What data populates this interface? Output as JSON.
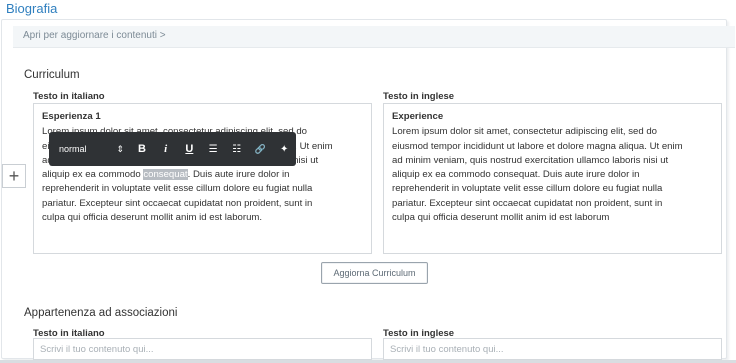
{
  "section_title": "Biografia",
  "expand_bar_label": "Apri per aggiornare i contenuti >",
  "curriculum": {
    "heading": "Curriculum",
    "label_it": "Testo in italiano",
    "label_en": "Testo in inglese",
    "it": {
      "heading": "Esperienza 1",
      "line1": "Lorem ipsum dolor sit amet, consectetur adipiscing elit, sed do",
      "line2": "eiusmod tempor incididunt ut labore et dolore magna aliqua. Ut enim",
      "line3": "ad minim veniam, quis nostrud exercitation ullamco laboris nisi ut",
      "line4_pre": "aliquip ex ea commodo ",
      "line4_sel": "consequat",
      "line4_post": ". Duis aute irure dolor in",
      "line5": "reprehenderit in voluptate velit esse cillum dolore eu fugiat nulla",
      "line6": "pariatur. Excepteur sint occaecat cupidatat non proident, sunt in",
      "line7": "culpa qui officia deserunt mollit anim id est laborum."
    },
    "en": {
      "heading": "Experience",
      "line1": "Lorem ipsum dolor sit amet, consectetur adipiscing elit, sed do",
      "line2": "eiusmod tempor incididunt ut labore et dolore magna aliqua. Ut enim",
      "line3": "ad minim veniam, quis nostrud exercitation ullamco laboris nisi ut",
      "line4": "aliquip ex ea commodo consequat. Duis aute irure dolor in",
      "line5": "reprehenderit in voluptate velit esse cillum dolore eu fugiat nulla",
      "line6": "pariatur. Excepteur sint occaecat cupidatat non proident, sunt in",
      "line7": "culpa qui officia deserunt mollit anim id est laborum"
    },
    "update_button": "Aggiorna Curriculum"
  },
  "toolbar": {
    "format_value": "normal",
    "format_arrows": "⇕",
    "bold": "B",
    "italic": "i",
    "underline": "U",
    "ordered_list": "☰",
    "bullet_list": "☷",
    "link": "🔗",
    "twitter": "✦",
    "plus": "+"
  },
  "associations": {
    "heading": "Appartenenza ad associazioni",
    "label_it": "Testo in italiano",
    "label_en": "Testo in inglese",
    "placeholder_it": "Scrivi il tuo contenuto qui...",
    "placeholder_en": "Scrivi il tuo contenuto qui..."
  },
  "colors": {
    "accent": "#2f7fbf",
    "toolbar_bg": "#2f3235"
  }
}
